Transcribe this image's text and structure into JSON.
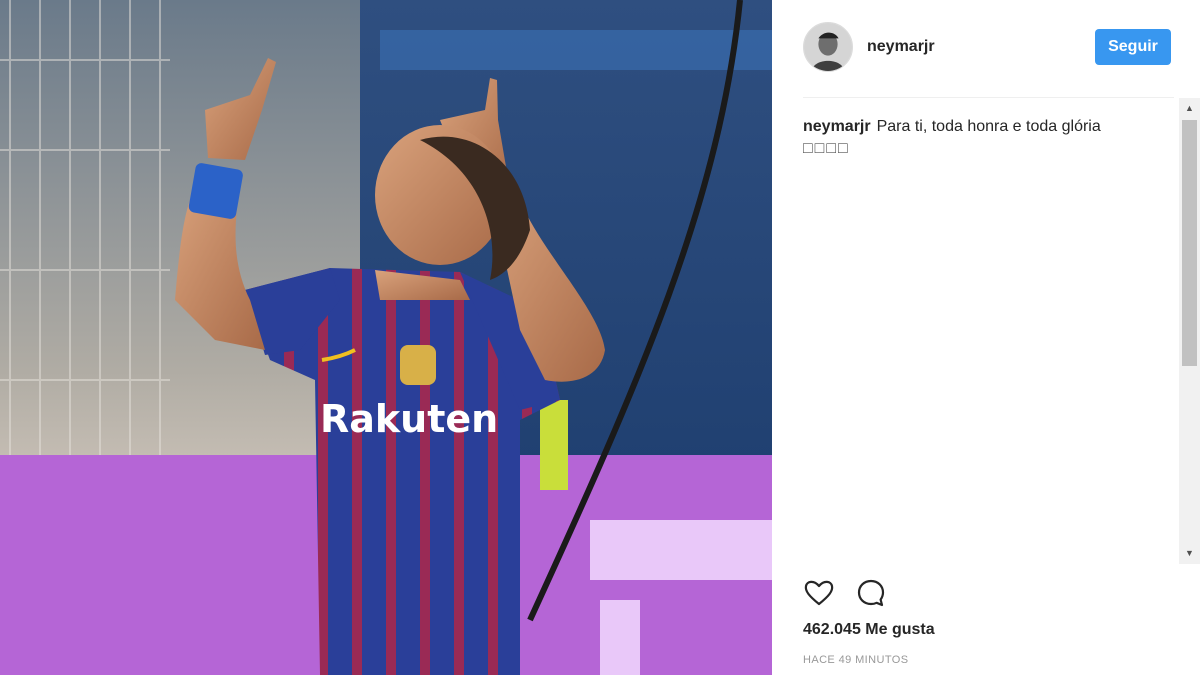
{
  "post": {
    "username": "neymarjr",
    "follow_label": "Seguir",
    "caption_username": "neymarjr",
    "caption_text": "Para ti, toda honra e toda glória",
    "caption_emojis": "□□□□",
    "likes": "462.045 Me gusta",
    "timestamp": "HACE 49 MINUTOS",
    "jersey_sponsor": "Rakuten"
  },
  "icons": {
    "like": "heart-icon",
    "comment": "comment-icon"
  },
  "colors": {
    "follow_button": "#3897f0",
    "text": "#262626",
    "muted": "#999999"
  }
}
